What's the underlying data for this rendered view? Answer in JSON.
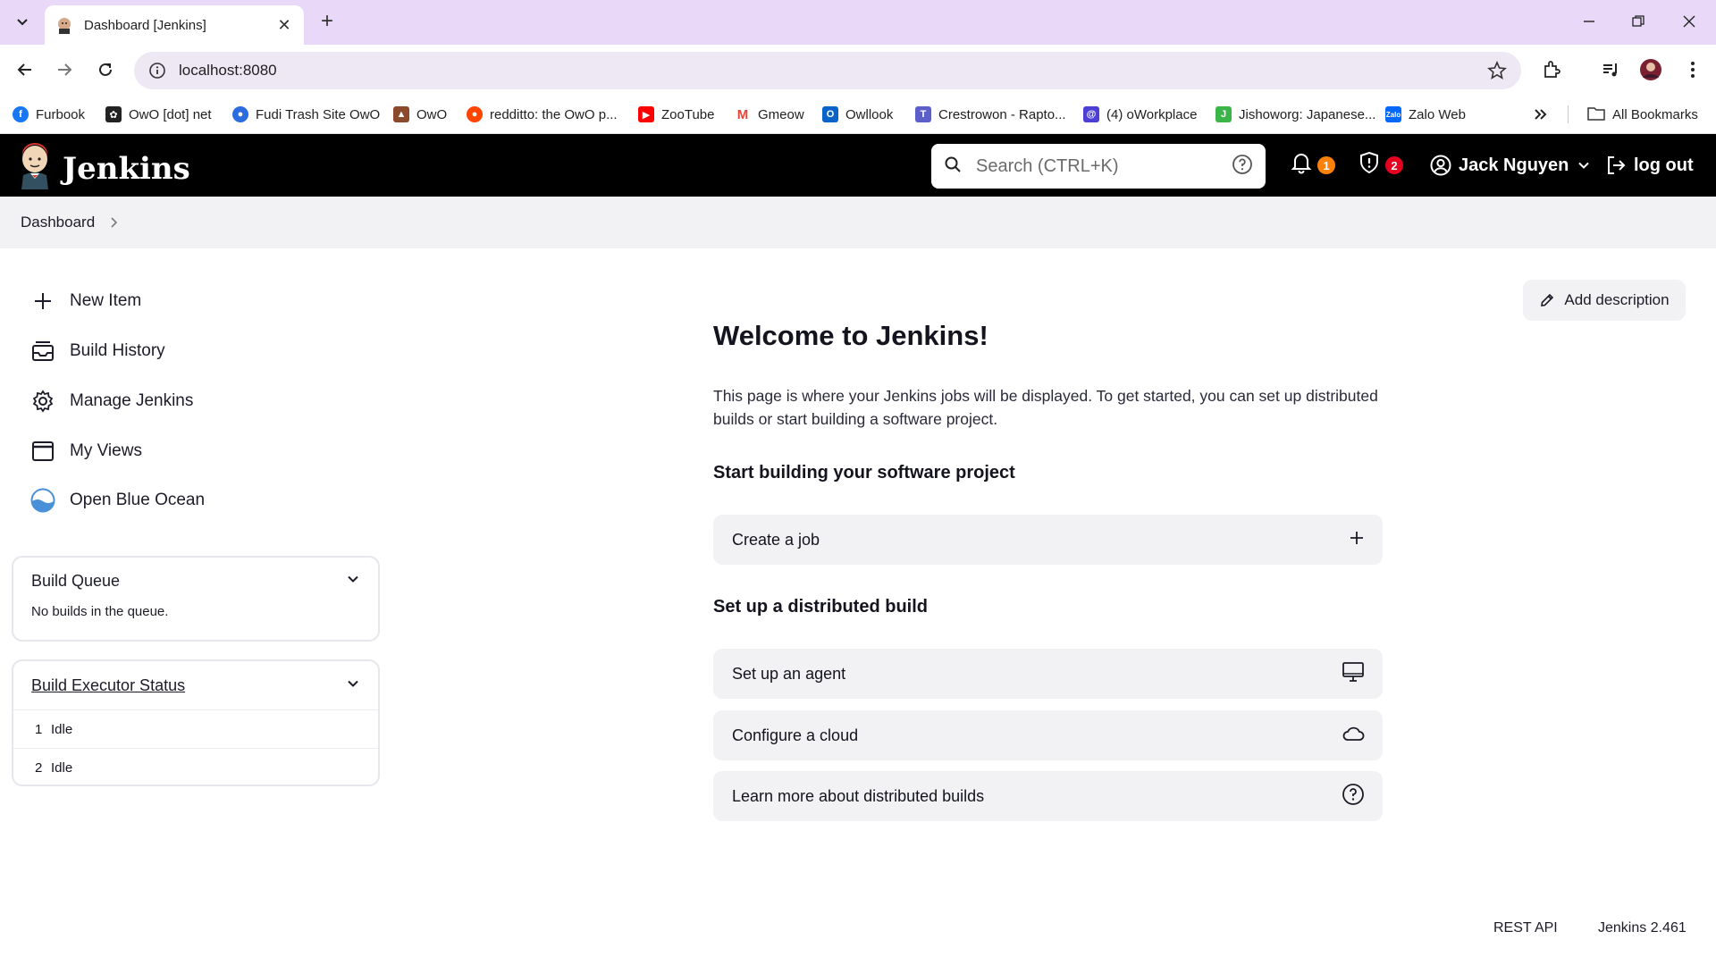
{
  "browser": {
    "tab_title": "Dashboard [Jenkins]",
    "url": "localhost:8080",
    "bookmarks": [
      {
        "label": "Furbook",
        "color": "#1877f2"
      },
      {
        "label": "OwO [dot] net",
        "color": "#222222"
      },
      {
        "label": "Fudi Trash Site OwO",
        "color": "#2d6cdf"
      },
      {
        "label": "OwO",
        "color": "#8b4a2b"
      },
      {
        "label": "redditto: the OwO p...",
        "color": "#ff4500"
      },
      {
        "label": "ZooTube",
        "color": "#ff0000"
      },
      {
        "label": "Gmeow",
        "color": "#ea4335"
      },
      {
        "label": "Owllook",
        "color": "#0a64c8"
      },
      {
        "label": "Crestrowon - Rapto...",
        "color": "#5b5fc7"
      },
      {
        "label": "(4) oWorkplace",
        "color": "#4b3fd6"
      },
      {
        "label": "Jishoworg: Japanese...",
        "color": "#3bb54a"
      },
      {
        "label": "Zalo Web",
        "color": "#0068ff"
      }
    ],
    "all_bookmarks_label": "All Bookmarks"
  },
  "header": {
    "brand": "Jenkins",
    "search_placeholder": "Search (CTRL+K)",
    "notifications_count": "1",
    "security_count": "2",
    "user_name": "Jack Nguyen",
    "logout_label": "log out"
  },
  "breadcrumb": {
    "item": "Dashboard"
  },
  "sidebar": {
    "items": [
      {
        "label": "New Item",
        "icon": "plus-icon"
      },
      {
        "label": "Build History",
        "icon": "inbox-icon"
      },
      {
        "label": "Manage Jenkins",
        "icon": "gear-icon"
      },
      {
        "label": "My Views",
        "icon": "window-icon"
      },
      {
        "label": "Open Blue Ocean",
        "icon": "blue-ocean-icon"
      }
    ],
    "build_queue": {
      "title": "Build Queue",
      "empty_text": "No builds in the queue."
    },
    "executors": {
      "title": "Build Executor Status",
      "rows": [
        {
          "num": "1",
          "status": "Idle"
        },
        {
          "num": "2",
          "status": "Idle"
        }
      ]
    }
  },
  "main": {
    "add_description": "Add description",
    "welcome": "Welcome to Jenkins!",
    "intro": "This page is where your Jenkins jobs will be displayed. To get started, you can set up distributed builds or start building a software project.",
    "section_build": "Start building your software project",
    "create_job": "Create a job",
    "section_distributed": "Set up a distributed build",
    "setup_agent": "Set up an agent",
    "configure_cloud": "Configure a cloud",
    "learn_more": "Learn more about distributed builds"
  },
  "footer": {
    "rest_api": "REST API",
    "version": "Jenkins 2.461"
  },
  "colors": {
    "header_bg": "#000000",
    "notif_badge": "#fe820a",
    "security_badge": "#e6001f",
    "tabstrip": "#e9d8f7"
  }
}
